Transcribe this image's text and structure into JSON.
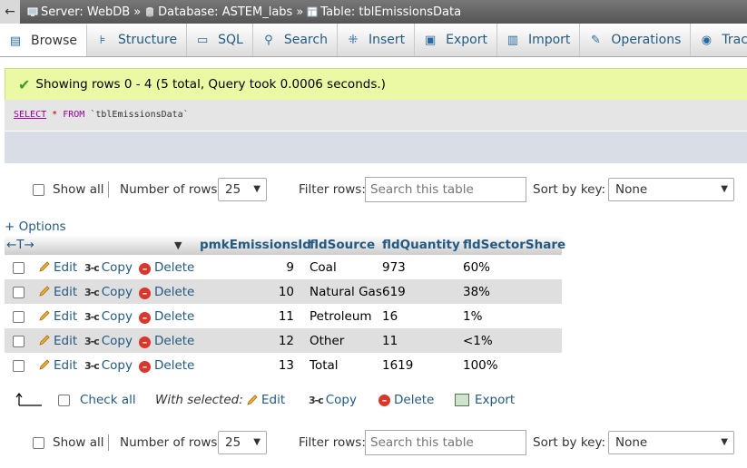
{
  "breadcrumb": {
    "back": "←",
    "server": "Server: WebDB",
    "database": "Database: ASTEM_labs",
    "table": "Table: tblEmissionsData",
    "separator": "»"
  },
  "tabs": [
    {
      "label": "Browse",
      "icon": "browse-icon",
      "active": true
    },
    {
      "label": "Structure",
      "icon": "structure-icon"
    },
    {
      "label": "SQL",
      "icon": "sql-icon"
    },
    {
      "label": "Search",
      "icon": "search-icon"
    },
    {
      "label": "Insert",
      "icon": "insert-icon"
    },
    {
      "label": "Export",
      "icon": "export-icon"
    },
    {
      "label": "Import",
      "icon": "import-icon"
    },
    {
      "label": "Operations",
      "icon": "wrench-icon"
    },
    {
      "label": "Tracki",
      "icon": "eye-icon"
    }
  ],
  "message": {
    "text": "Showing rows 0 - 4 (5 total, Query took 0.0006 seconds.)",
    "color": "#ebf8a4"
  },
  "sql": {
    "select": "SELECT",
    "star": "*",
    "from": "FROM",
    "table": "`tblEmissionsData`"
  },
  "nav": {
    "show_all": "Show all",
    "rows_label": "Number of rows:",
    "rows_value": "25",
    "filter_label": "Filter rows:",
    "filter_placeholder": "Search this table",
    "sort_label": "Sort by key:",
    "sort_value": "None"
  },
  "options_link": "+ Options",
  "table": {
    "arrows": "←T→",
    "columns": [
      "pmkEmissionsId",
      "fldSource",
      "fldQuantity",
      "fldSectorShare"
    ],
    "actions": {
      "edit": "Edit",
      "copy": "Copy",
      "delete": "Delete"
    },
    "rows": [
      {
        "id": "9",
        "source": "Coal",
        "quantity": "973",
        "share": "60%"
      },
      {
        "id": "10",
        "source": "Natural Gas",
        "quantity": "619",
        "share": "38%"
      },
      {
        "id": "11",
        "source": "Petroleum",
        "quantity": "16",
        "share": "1%"
      },
      {
        "id": "12",
        "source": "Other",
        "quantity": "11",
        "share": "<1%"
      },
      {
        "id": "13",
        "source": "Total",
        "quantity": "1619",
        "share": "100%"
      }
    ]
  },
  "with_selected": {
    "check_all": "Check all",
    "label": "With selected:",
    "edit": "Edit",
    "copy": "Copy",
    "delete": "Delete",
    "export": "Export"
  }
}
